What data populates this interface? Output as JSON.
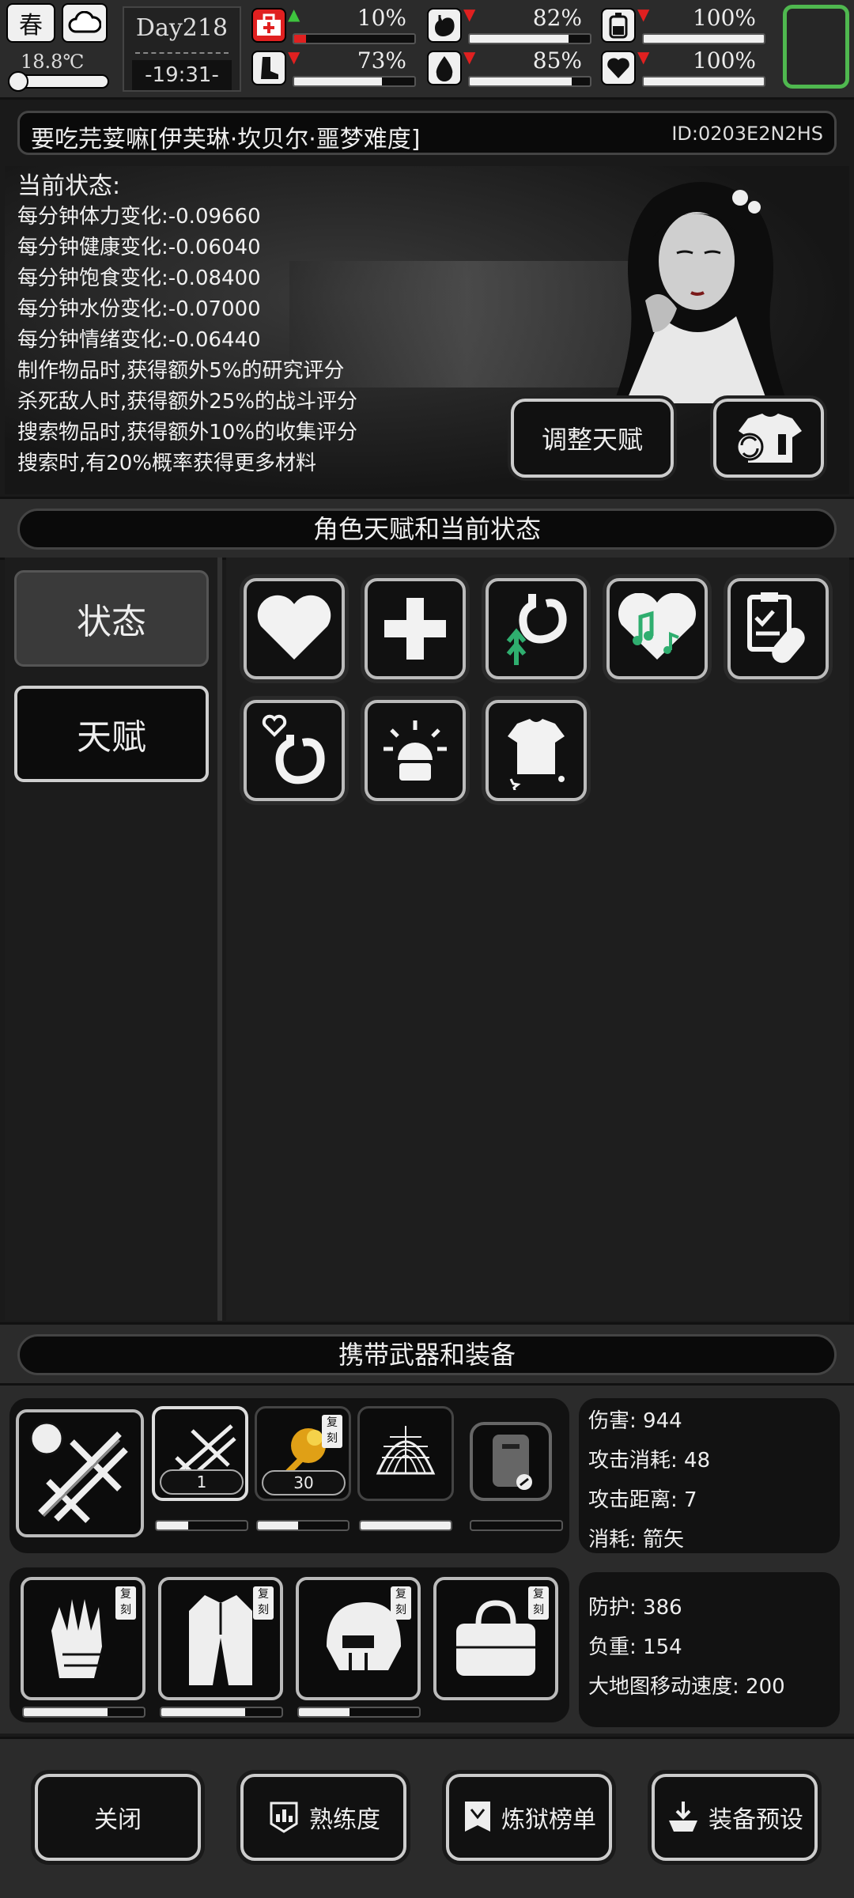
{
  "top": {
    "season": "春",
    "temperature": "18.8℃",
    "day": "Day218",
    "clock": "-19:31-",
    "stats": [
      {
        "key": "health",
        "icon": "medkit-icon",
        "trend": "up",
        "value": "10%",
        "level": 0.1,
        "critical": true
      },
      {
        "key": "satiety",
        "icon": "stomach-icon",
        "trend": "down",
        "value": "82%",
        "level": 0.82,
        "critical": false
      },
      {
        "key": "energy",
        "icon": "battery-icon",
        "trend": "down",
        "value": "100%",
        "level": 1.0,
        "critical": false
      },
      {
        "key": "stamina",
        "icon": "boot-icon",
        "trend": "down",
        "value": "73%",
        "level": 0.73,
        "critical": false
      },
      {
        "key": "water",
        "icon": "water-drop-icon",
        "trend": "down",
        "value": "85%",
        "level": 0.85,
        "critical": false
      },
      {
        "key": "mood",
        "icon": "heart-icon",
        "trend": "down",
        "value": "100%",
        "level": 1.0,
        "critical": false
      }
    ],
    "colors": {
      "up": "#3ec43e",
      "down": "#e02020",
      "highlight": "#4fb84f"
    }
  },
  "character": {
    "name": "要吃芫荽嘛[伊芙琳·坎贝尔·噩梦难度]",
    "id": "ID:0203E2N2HS"
  },
  "status": {
    "title": "当前状态:",
    "lines": [
      "每分钟体力变化:-0.09660",
      "每分钟健康变化:-0.06040",
      "每分钟饱食变化:-0.08400",
      "每分钟水份变化:-0.07000",
      "每分钟情绪变化:-0.06440",
      "制作物品时,获得额外5%的研究评分",
      "杀死敌人时,获得额外25%的战斗评分",
      "搜索物品时,获得额外10%的收集评分",
      "搜索时,有20%概率获得更多材料"
    ],
    "adjust_talent": "调整天赋"
  },
  "talent_section": {
    "title": "角色天赋和当前状态",
    "tabs": [
      "状态",
      "天赋"
    ],
    "icons": [
      "heart-icon",
      "cross-icon",
      "stomach-arrows-icon",
      "music-heart-icon",
      "clipboard-pill-icon",
      "stomach-heart-icon",
      "alarm-icon",
      "shirt-stars-icon"
    ]
  },
  "equip_section": {
    "title": "携带武器和装备",
    "weapon_slots": [
      {
        "name": "crossbow",
        "count": "1",
        "durability": 0.35,
        "copy": false
      },
      {
        "name": "firework",
        "count": "30",
        "durability": 0.45,
        "copy": true
      },
      {
        "name": "net",
        "count": "",
        "durability": 1.0,
        "copy": false
      },
      {
        "name": "riot-shield",
        "count": "",
        "durability": 0.0,
        "copy": false
      }
    ],
    "armor_slots": [
      {
        "name": "gloves",
        "durability": 0.7,
        "copy": true
      },
      {
        "name": "coat",
        "durability": 0.7,
        "copy": true
      },
      {
        "name": "helmet",
        "durability": 0.42,
        "copy": true
      },
      {
        "name": "bag",
        "durability": 0.0,
        "copy": true
      }
    ],
    "copy_label": "复刻",
    "weapon_info": [
      "伤害: 944",
      "攻击消耗: 48",
      "攻击距离: 7",
      "消耗: 箭矢"
    ],
    "armor_info": [
      "防护: 386",
      "负重: 154",
      "大地图移动速度: 200"
    ]
  },
  "bottom": {
    "close": "关闭",
    "proficiency": "熟练度",
    "hell_list": "炼狱榜单",
    "equip_preset": "装备预设"
  }
}
